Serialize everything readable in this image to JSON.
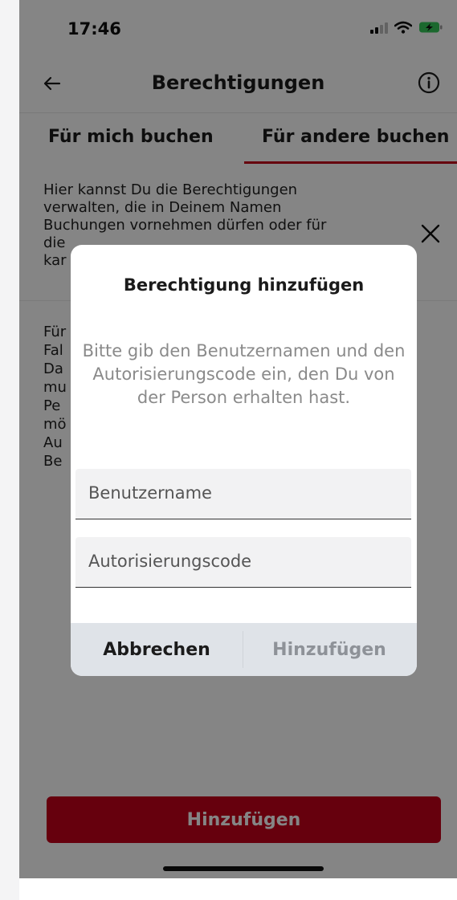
{
  "status_bar": {
    "time": "17:46"
  },
  "header": {
    "title": "Berechtigungen",
    "back_icon": "arrow-left-icon",
    "info_icon": "info-icon"
  },
  "tabs": [
    {
      "label": "Für mich buchen",
      "active": false
    },
    {
      "label": "Für andere buchen",
      "active": true
    }
  ],
  "info_box": {
    "text_lines": [
      "Hier kannst Du die Berechtigungen",
      "verwalten, die in Deinem Namen",
      "Buchungen vornehmen dürfen oder für",
      "die",
      "kar"
    ],
    "close_icon": "close-icon"
  },
  "body_text_lines": [
    "Für",
    "Fal",
    "Da",
    "mu",
    "Pe",
    "mö",
    "Au",
    "Be"
  ],
  "dialog": {
    "title": "Berechtigung hinzufügen",
    "message": "Bitte gib den Benutzernamen und den Autorisierungscode ein, den Du von der Person erhalten hast.",
    "username_placeholder": "Benutzername",
    "code_placeholder": "Autorisierungscode",
    "cancel_label": "Abbrechen",
    "add_label": "Hinzufügen"
  },
  "primary_button": {
    "label": "Hinzufügen"
  },
  "colors": {
    "accent": "#c4001a",
    "overlay": "rgba(0,0,0,0.48)",
    "dialog_actions_bg": "#dfe3e8",
    "disabled_text": "#8e9298"
  }
}
